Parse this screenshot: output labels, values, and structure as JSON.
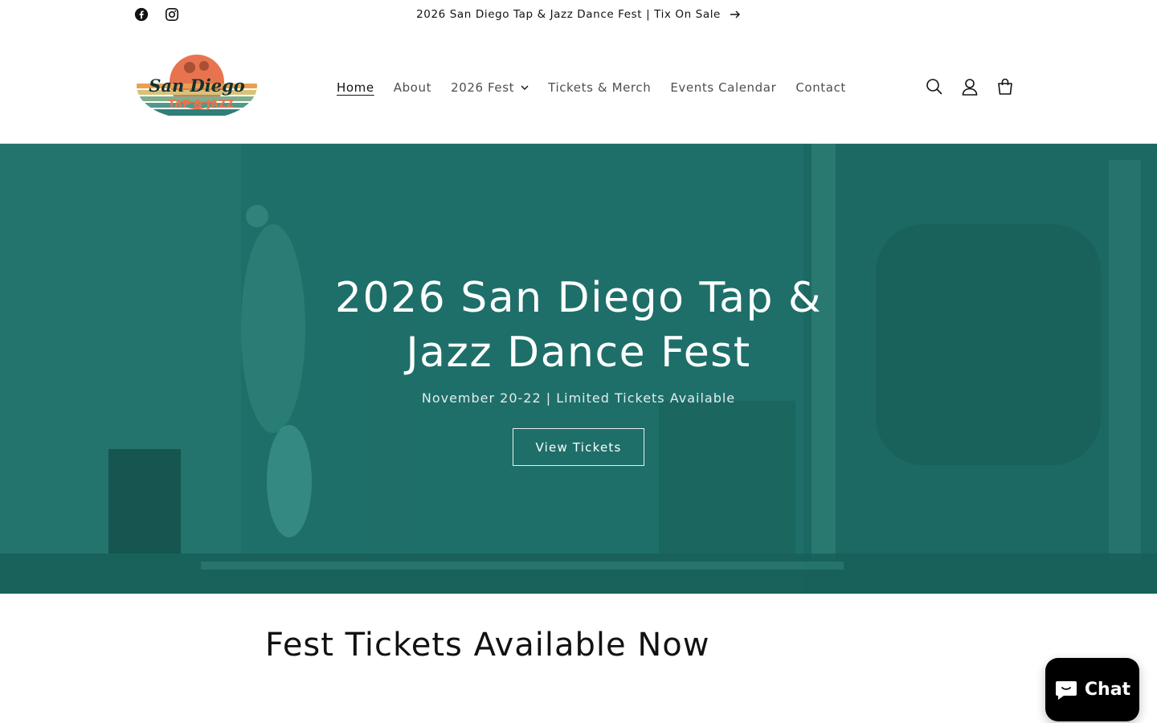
{
  "announcement": {
    "text": "2026 San Diego Tap & Jazz Dance Fest | Tix On Sale",
    "social": [
      "facebook-icon",
      "instagram-icon"
    ]
  },
  "logo": {
    "line1": "San Diego",
    "line2": "TAP & JAZZ",
    "colors": {
      "sun": "#e8744f",
      "teal": "#2f7f79",
      "orange": "#e9a04f",
      "green": "#4f9a8a",
      "text": "#10322f"
    }
  },
  "nav": {
    "items": [
      {
        "label": "Home",
        "active": true
      },
      {
        "label": "About"
      },
      {
        "label": "2026 Fest",
        "dropdown": true
      },
      {
        "label": "Tickets & Merch"
      },
      {
        "label": "Events Calendar"
      },
      {
        "label": "Contact"
      }
    ]
  },
  "header_icons": [
    "search-icon",
    "account-icon",
    "cart-icon"
  ],
  "hero": {
    "title": "2026 San Diego Tap & Jazz Dance Fest",
    "subtitle": "November 20-22 | Limited Tickets Available",
    "button": "View Tickets",
    "overlay_color": "#1d6f68"
  },
  "section": {
    "title": "Fest Tickets Available Now"
  },
  "chat": {
    "label": "Chat"
  }
}
